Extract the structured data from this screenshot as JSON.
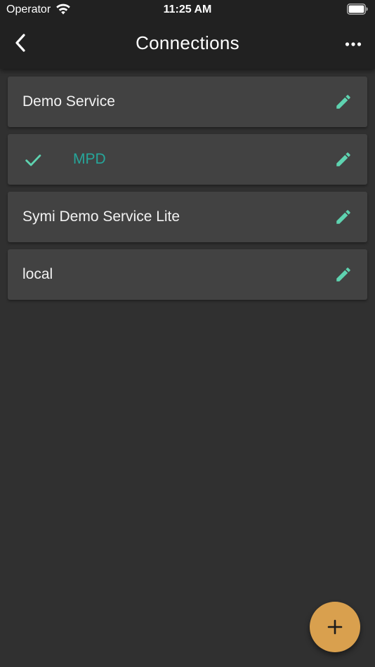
{
  "status_bar": {
    "carrier": "Operator",
    "time": "11:25 AM"
  },
  "app_bar": {
    "title": "Connections",
    "back_icon": "chevron-left-icon",
    "more_icon": "more-horizontal-icon"
  },
  "connections": [
    {
      "label": "Demo Service",
      "selected": false
    },
    {
      "label": "MPD",
      "selected": true
    },
    {
      "label": "Symi Demo Service Lite",
      "selected": false
    },
    {
      "label": "local",
      "selected": false
    }
  ],
  "fab": {
    "icon": "plus-icon"
  },
  "colors": {
    "background": "#303030",
    "app_bar": "#212121",
    "card": "#424242",
    "accent_teal": "#26a69a",
    "edit_icon": "#5ed3b0",
    "fab": "#d9a04e"
  }
}
